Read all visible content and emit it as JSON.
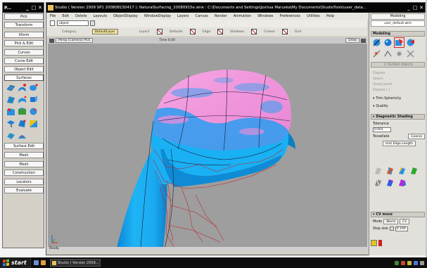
{
  "palette": {
    "title": "P...",
    "buttons": [
      "Pick",
      "Transform",
      "Xform",
      "Pick & Edit",
      "Curves",
      "Curve Edit",
      "Object Edit",
      "Surfaces",
      "Surface Edit",
      "Mesh",
      "Mesh",
      "Construction",
      "Locators",
      "Evaluate"
    ]
  },
  "main_window": {
    "title": "Studio ( Version 2009 SP1 200808150417 ): NaturalSurfacing_20080915e.wire : C:\\Documents and Settings\\Joshua Maruska\\My Documents\\StudioTools\\user_data..."
  },
  "menubar": [
    "File",
    "Edit",
    "Delete",
    "Layouts",
    "ObjectDisplay",
    "WindowDisplay",
    "Layers",
    "Canvas",
    "Render",
    "Animation",
    "Windows",
    "Preferences",
    "Utilities",
    "Help"
  ],
  "toolbar": {
    "layer_label": "object",
    "categories": [
      "Category",
      "DefaultLayer",
      "Layer1",
      "Defaults",
      "Edge",
      "Shadows",
      "Crease",
      "Grid"
    ],
    "modeling_label": "Modeling",
    "user_label": "user_default.wire"
  },
  "viewport": {
    "title": "Persp (Camera) Pick",
    "time_label": "Time 0.00",
    "shade_label": "Draw",
    "status": "Ready"
  },
  "control_panel": {
    "header": "Modeling",
    "section1": "2 divided objects",
    "ghost_rows": [
      "Degree",
      "Spans",
      "Quad panel",
      "Degree ( )"
    ],
    "row_texts": [
      "Trim Sphericity",
      "Quality"
    ],
    "shading_header": "Diagnostic Shading",
    "tolerance_label": "Tolerance",
    "tolerance_value": "0.001",
    "tessellation_label": "Tessellate",
    "coarse_label": "Coarse",
    "edge_length_label": "Unit Edge Length",
    "cv_header": "CV move",
    "mode_label": "Mode",
    "mode_value": "World",
    "cv_label": "CV",
    "step_label": "Step size",
    "step_value": "0.100"
  },
  "taskbar": {
    "start_label": "start",
    "task_label": "Studio ( Version 2009..."
  },
  "colors": {
    "body_blue": "#1aa9f0",
    "cap_pink": "#f08ad8",
    "viewport_gray": "#9e9e9e",
    "title_black": "#050505"
  }
}
